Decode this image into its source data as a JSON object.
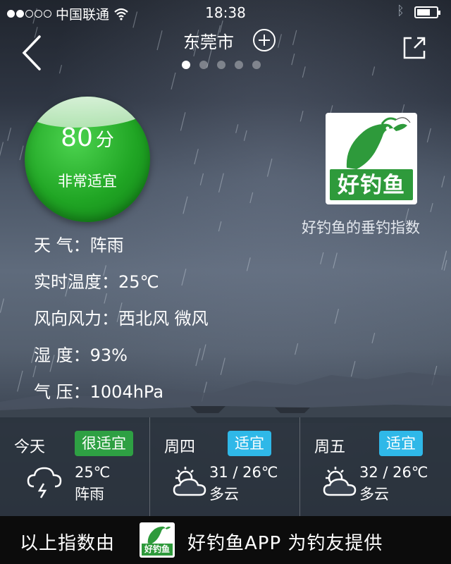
{
  "status_bar": {
    "carrier": "中国联通",
    "time": "18:38",
    "signal_filled": 2,
    "signal_total": 5,
    "battery_level": 0.7
  },
  "nav": {
    "city": "东莞市",
    "page_count": 5,
    "active_page": 0
  },
  "score": {
    "value": "80",
    "unit": "分",
    "label": "非常适宜",
    "color": "#20a524"
  },
  "logo": {
    "text": "好钓鱼",
    "caption": "好钓鱼的垂钓指数",
    "brand_color": "#2e9a3b"
  },
  "current": [
    {
      "label": "天 气：",
      "value": "阵雨"
    },
    {
      "label": "实时温度：",
      "value": "25℃"
    },
    {
      "label": "风向风力：",
      "value": "西北风 微风"
    },
    {
      "label": "湿 度：",
      "value": "93%"
    },
    {
      "label": "气 压：",
      "value": "1004hPa"
    }
  ],
  "forecast": [
    {
      "day": "今天",
      "rating": "很适宜",
      "rating_color": "green",
      "temp": "25℃",
      "condition": "阵雨",
      "icon": "rain-cloud-icon"
    },
    {
      "day": "周四",
      "rating": "适宜",
      "rating_color": "blue",
      "temp": "31 / 26℃",
      "condition": "多云",
      "icon": "partly-cloudy-icon"
    },
    {
      "day": "周五",
      "rating": "适宜",
      "rating_color": "blue",
      "temp": "32 / 26℃",
      "condition": "多云",
      "icon": "partly-cloudy-icon"
    }
  ],
  "footer": {
    "text_before": "以上指数由",
    "text_after": "好钓鱼APP 为钓友提供",
    "logo_text": "好钓鱼"
  }
}
